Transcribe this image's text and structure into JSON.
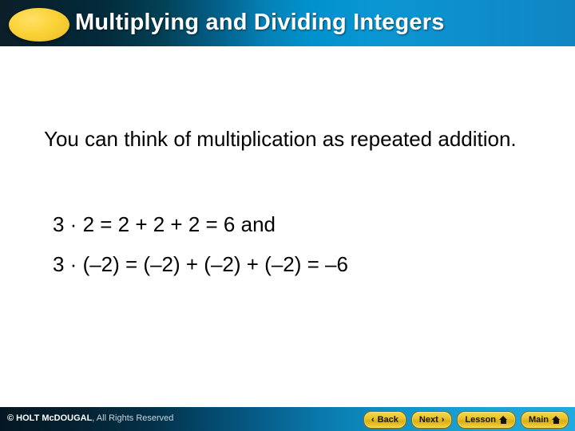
{
  "header": {
    "title": "Multiplying and Dividing Integers",
    "decor_icon": "yellow-ellipse",
    "bg_start_color": "#0c1e28",
    "bg_end_color": "#1185c4",
    "accent_color": "#fbd338"
  },
  "content": {
    "lead_text": "You can think of multiplication as repeated addition.",
    "equations": [
      "3 · 2 = 2 + 2 + 2 = 6 and",
      "3 · (–2) = (–2) + (–2) + (–2) = –6"
    ]
  },
  "footer": {
    "copyright_bold": "© HOLT McDOUGAL",
    "copyright_rest": ", All Rights Reserved",
    "buttons": [
      {
        "label": "Back",
        "icon": "chevron-left-icon",
        "glyph": "‹"
      },
      {
        "label": "Next",
        "icon": "chevron-right-icon",
        "glyph": "›"
      },
      {
        "label": "Lesson",
        "icon": "home-icon",
        "glyph": ""
      },
      {
        "label": "Main",
        "icon": "home-icon",
        "glyph": ""
      }
    ],
    "button_color": "#e9c32c",
    "bg_start_color": "#041824",
    "bg_end_color": "#22a9dd"
  }
}
